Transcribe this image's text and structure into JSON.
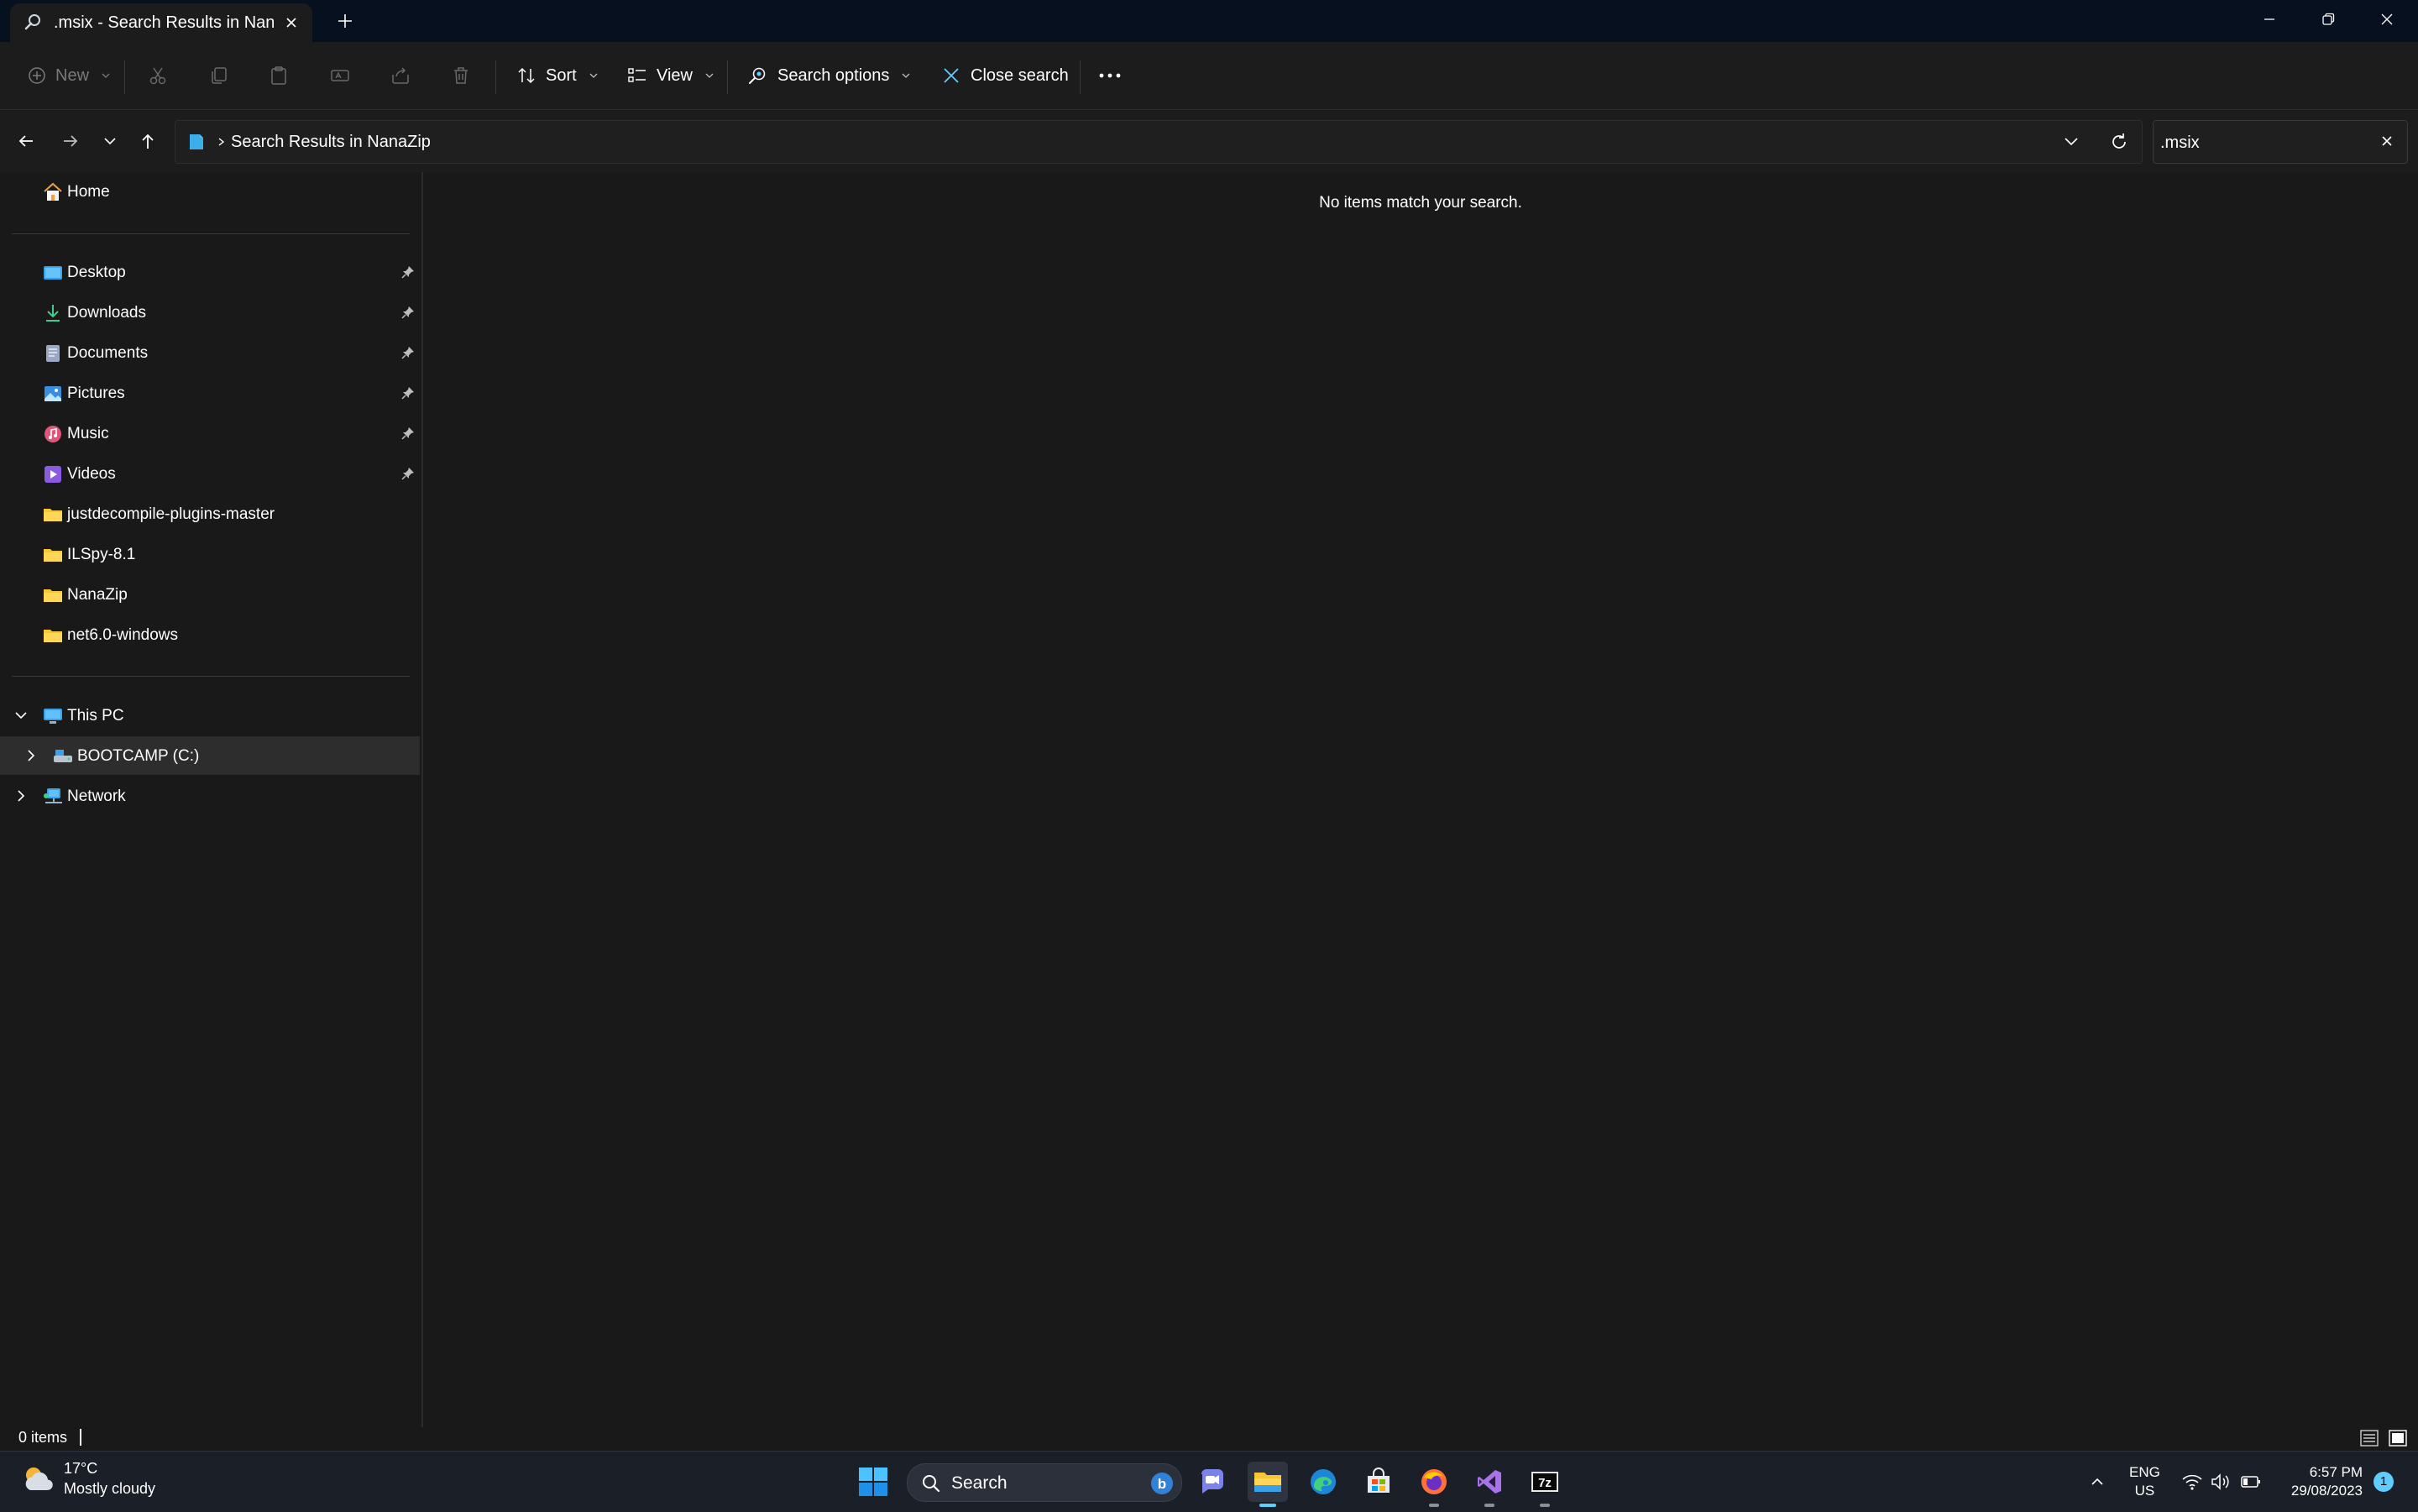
{
  "window": {
    "tab_title": ".msix - Search Results in NanaZip",
    "new_tab_symbol": "+"
  },
  "toolbar": {
    "new_label": "New",
    "sort_label": "Sort",
    "view_label": "View",
    "search_options_label": "Search options",
    "close_search_label": "Close search"
  },
  "address": {
    "breadcrumb": "Search Results in NanaZip",
    "search_value": ".msix"
  },
  "sidebar": {
    "home": "Home",
    "quick_access": [
      {
        "label": "Desktop",
        "icon": "desktop-icon",
        "pinned": true
      },
      {
        "label": "Downloads",
        "icon": "downloads-icon",
        "pinned": true
      },
      {
        "label": "Documents",
        "icon": "documents-icon",
        "pinned": true
      },
      {
        "label": "Pictures",
        "icon": "pictures-icon",
        "pinned": true
      },
      {
        "label": "Music",
        "icon": "music-icon",
        "pinned": true
      },
      {
        "label": "Videos",
        "icon": "videos-icon",
        "pinned": true
      },
      {
        "label": "justdecompile-plugins-master",
        "icon": "folder-icon",
        "pinned": false
      },
      {
        "label": "ILSpy-8.1",
        "icon": "folder-icon",
        "pinned": false
      },
      {
        "label": "NanaZip",
        "icon": "folder-icon",
        "pinned": false
      },
      {
        "label": "net6.0-windows",
        "icon": "folder-icon",
        "pinned": false
      }
    ],
    "this_pc": "This PC",
    "drive": "BOOTCAMP (C:)",
    "network": "Network"
  },
  "content": {
    "empty_message": "No items match your search."
  },
  "status": {
    "item_count": "0 items"
  },
  "taskbar": {
    "weather_temp": "17°C",
    "weather_condition": "Mostly cloudy",
    "search_label": "Search",
    "lang_top": "ENG",
    "lang_bottom": "US",
    "time": "6:57 PM",
    "date": "29/08/2023",
    "notification_count": "1",
    "bing_letter": "b"
  },
  "colors": {
    "accent": "#60cdff",
    "folder": "#f8c537",
    "background": "#191919",
    "titlebar": "#06101e"
  }
}
